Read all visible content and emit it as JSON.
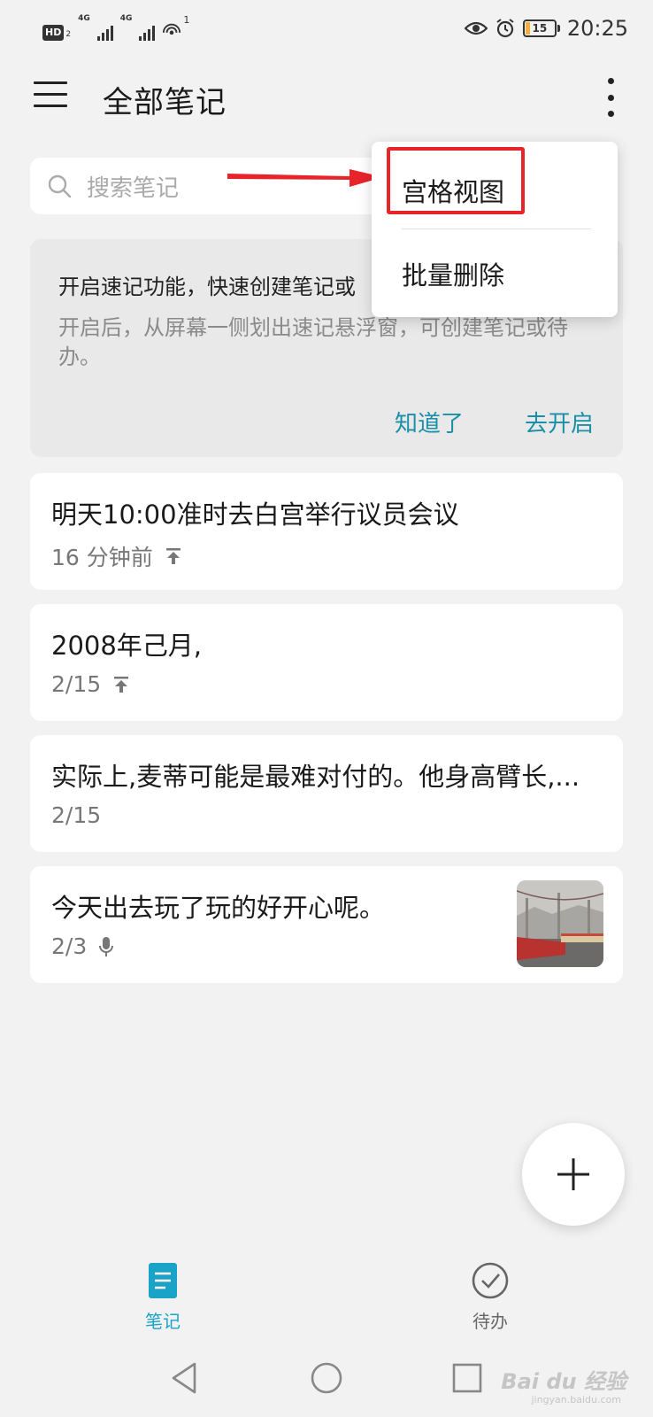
{
  "status_bar": {
    "hd_label": "HD",
    "hd_sub": "2",
    "network_1": "4G",
    "network_2": "4G",
    "wifi_count": "1",
    "battery_level": "15",
    "battery_fraction": 0.15,
    "time": "20:25",
    "icons": [
      "eye-icon",
      "alarm-icon",
      "battery-icon"
    ]
  },
  "app_bar": {
    "title": "全部笔记",
    "menu_icon": "hamburger-menu-icon",
    "more_icon": "more-vertical-icon"
  },
  "search": {
    "placeholder": "搜索笔记",
    "icon": "search-icon"
  },
  "tip_card": {
    "title": "开启速记功能，快速创建笔记或",
    "description": "开启后，从屏幕一侧划出速记悬浮窗，可创建笔记或待办。",
    "dismiss_label": "知道了",
    "enable_label": "去开启"
  },
  "notes": [
    {
      "title": "明天10:00准时去白宫举行议员会议",
      "meta": "16 分钟前",
      "icon": "pin-top-icon"
    },
    {
      "title": "2008年己月,",
      "meta": "2/15",
      "icon": "pin-top-icon"
    },
    {
      "title": "实际上,麦蒂可能是最难对付的。他身高臂长,...",
      "meta": "2/15",
      "icon": ""
    },
    {
      "title": "今天出去玩了玩的好开心呢。",
      "meta": "2/3",
      "icon": "microphone-icon",
      "has_thumbnail": true
    }
  ],
  "popup_menu": {
    "items": [
      "宫格视图",
      "批量删除"
    ],
    "highlight_color": "#e8242a"
  },
  "fab": {
    "icon": "plus-icon"
  },
  "bottom_nav": {
    "items": [
      {
        "label": "笔记",
        "icon": "note-icon",
        "active": true
      },
      {
        "label": "待办",
        "icon": "check-circle-icon",
        "active": false
      }
    ],
    "active_color": "#1aa3c8"
  },
  "system_nav": {
    "buttons": [
      "back-icon",
      "home-icon",
      "recent-apps-icon"
    ],
    "watermark": "Bai du 经验",
    "watermark_sub": "jingyan.baidu.com"
  },
  "colors": {
    "accent": "#1aa3c8",
    "link": "#1a8fa8",
    "background": "#f2f2f2",
    "annotation_red": "#e8242a"
  }
}
